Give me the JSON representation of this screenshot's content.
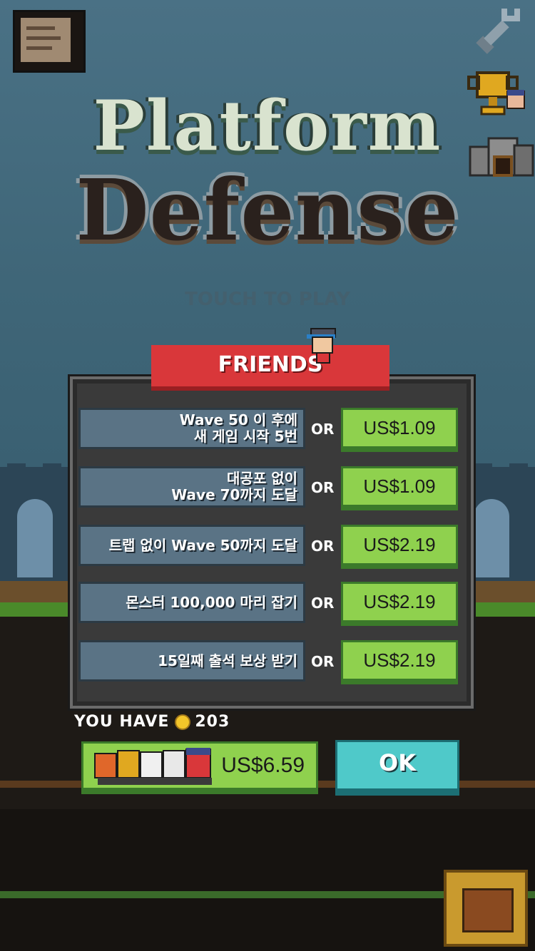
{
  "title": {
    "line1": "Platform",
    "line2": "Defense",
    "touch": "TOUCH TO PLAY"
  },
  "dialog": {
    "banner": "FRIENDS",
    "or_label": "OR",
    "rows": [
      {
        "task": "Wave 50 이 후에\n새 게임 시작 5번",
        "price": "US$1.09"
      },
      {
        "task": "대공포 없이\nWave 70까지 도달",
        "price": "US$1.09"
      },
      {
        "task": "트랩 없이 Wave 50까지 도달",
        "price": "US$2.19"
      },
      {
        "task": "몬스터 100,000 마리 잡기",
        "price": "US$2.19"
      },
      {
        "task": "15일째 출석 보상 받기",
        "price": "US$2.19"
      }
    ]
  },
  "wallet": {
    "label": "YOU HAVE",
    "coins": "203"
  },
  "bundle": {
    "price": "US$6.59"
  },
  "ok_label": "OK",
  "icons": {
    "top_left": "notes-icon",
    "top_right": [
      "wrench-icon",
      "trophy-icon",
      "mine-icon"
    ],
    "bottom_right": "treasure-chest-icon"
  },
  "colors": {
    "banner": "#d9373a",
    "price_button": "#8fd14e",
    "ok_button": "#4fc9c9",
    "task_bg": "#5a7385"
  }
}
